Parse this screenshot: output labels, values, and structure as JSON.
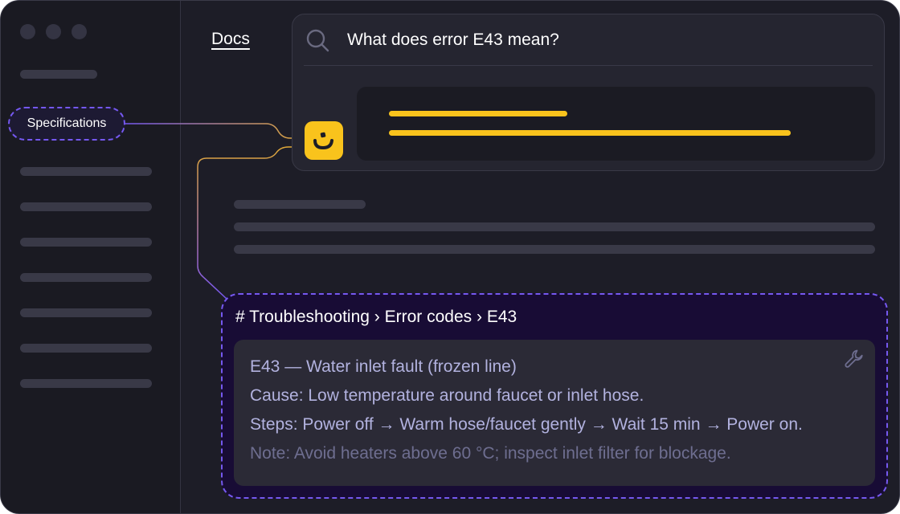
{
  "window": {
    "traffic_lights": [
      "close-dot",
      "minimize-dot",
      "maximize-dot"
    ]
  },
  "sidebar": {
    "highlighted_item": "Specifications"
  },
  "nav": {
    "docs_link": "Docs"
  },
  "search": {
    "query": "What does error E43 mean?",
    "icon": "search-icon"
  },
  "assistant": {
    "icon": "smile-icon",
    "accent_color": "#f9c31c"
  },
  "result": {
    "breadcrumb": "# Troubleshooting › Error codes › E43",
    "title": "E43 — Water inlet fault (frozen line)",
    "cause": "Cause: Low temperature around faucet or inlet hose.",
    "steps": "Steps: Power off → Warm hose/faucet gently → Wait 15 min → Power on.",
    "note": "Note: Avoid heaters above 60 °C; inspect inlet filter for blockage.",
    "icon": "wrench-icon"
  },
  "colors": {
    "background": "#1d1d27",
    "highlight_border": "#7558f0",
    "accent": "#f9c31c",
    "snippet_bg": "#180c35"
  }
}
